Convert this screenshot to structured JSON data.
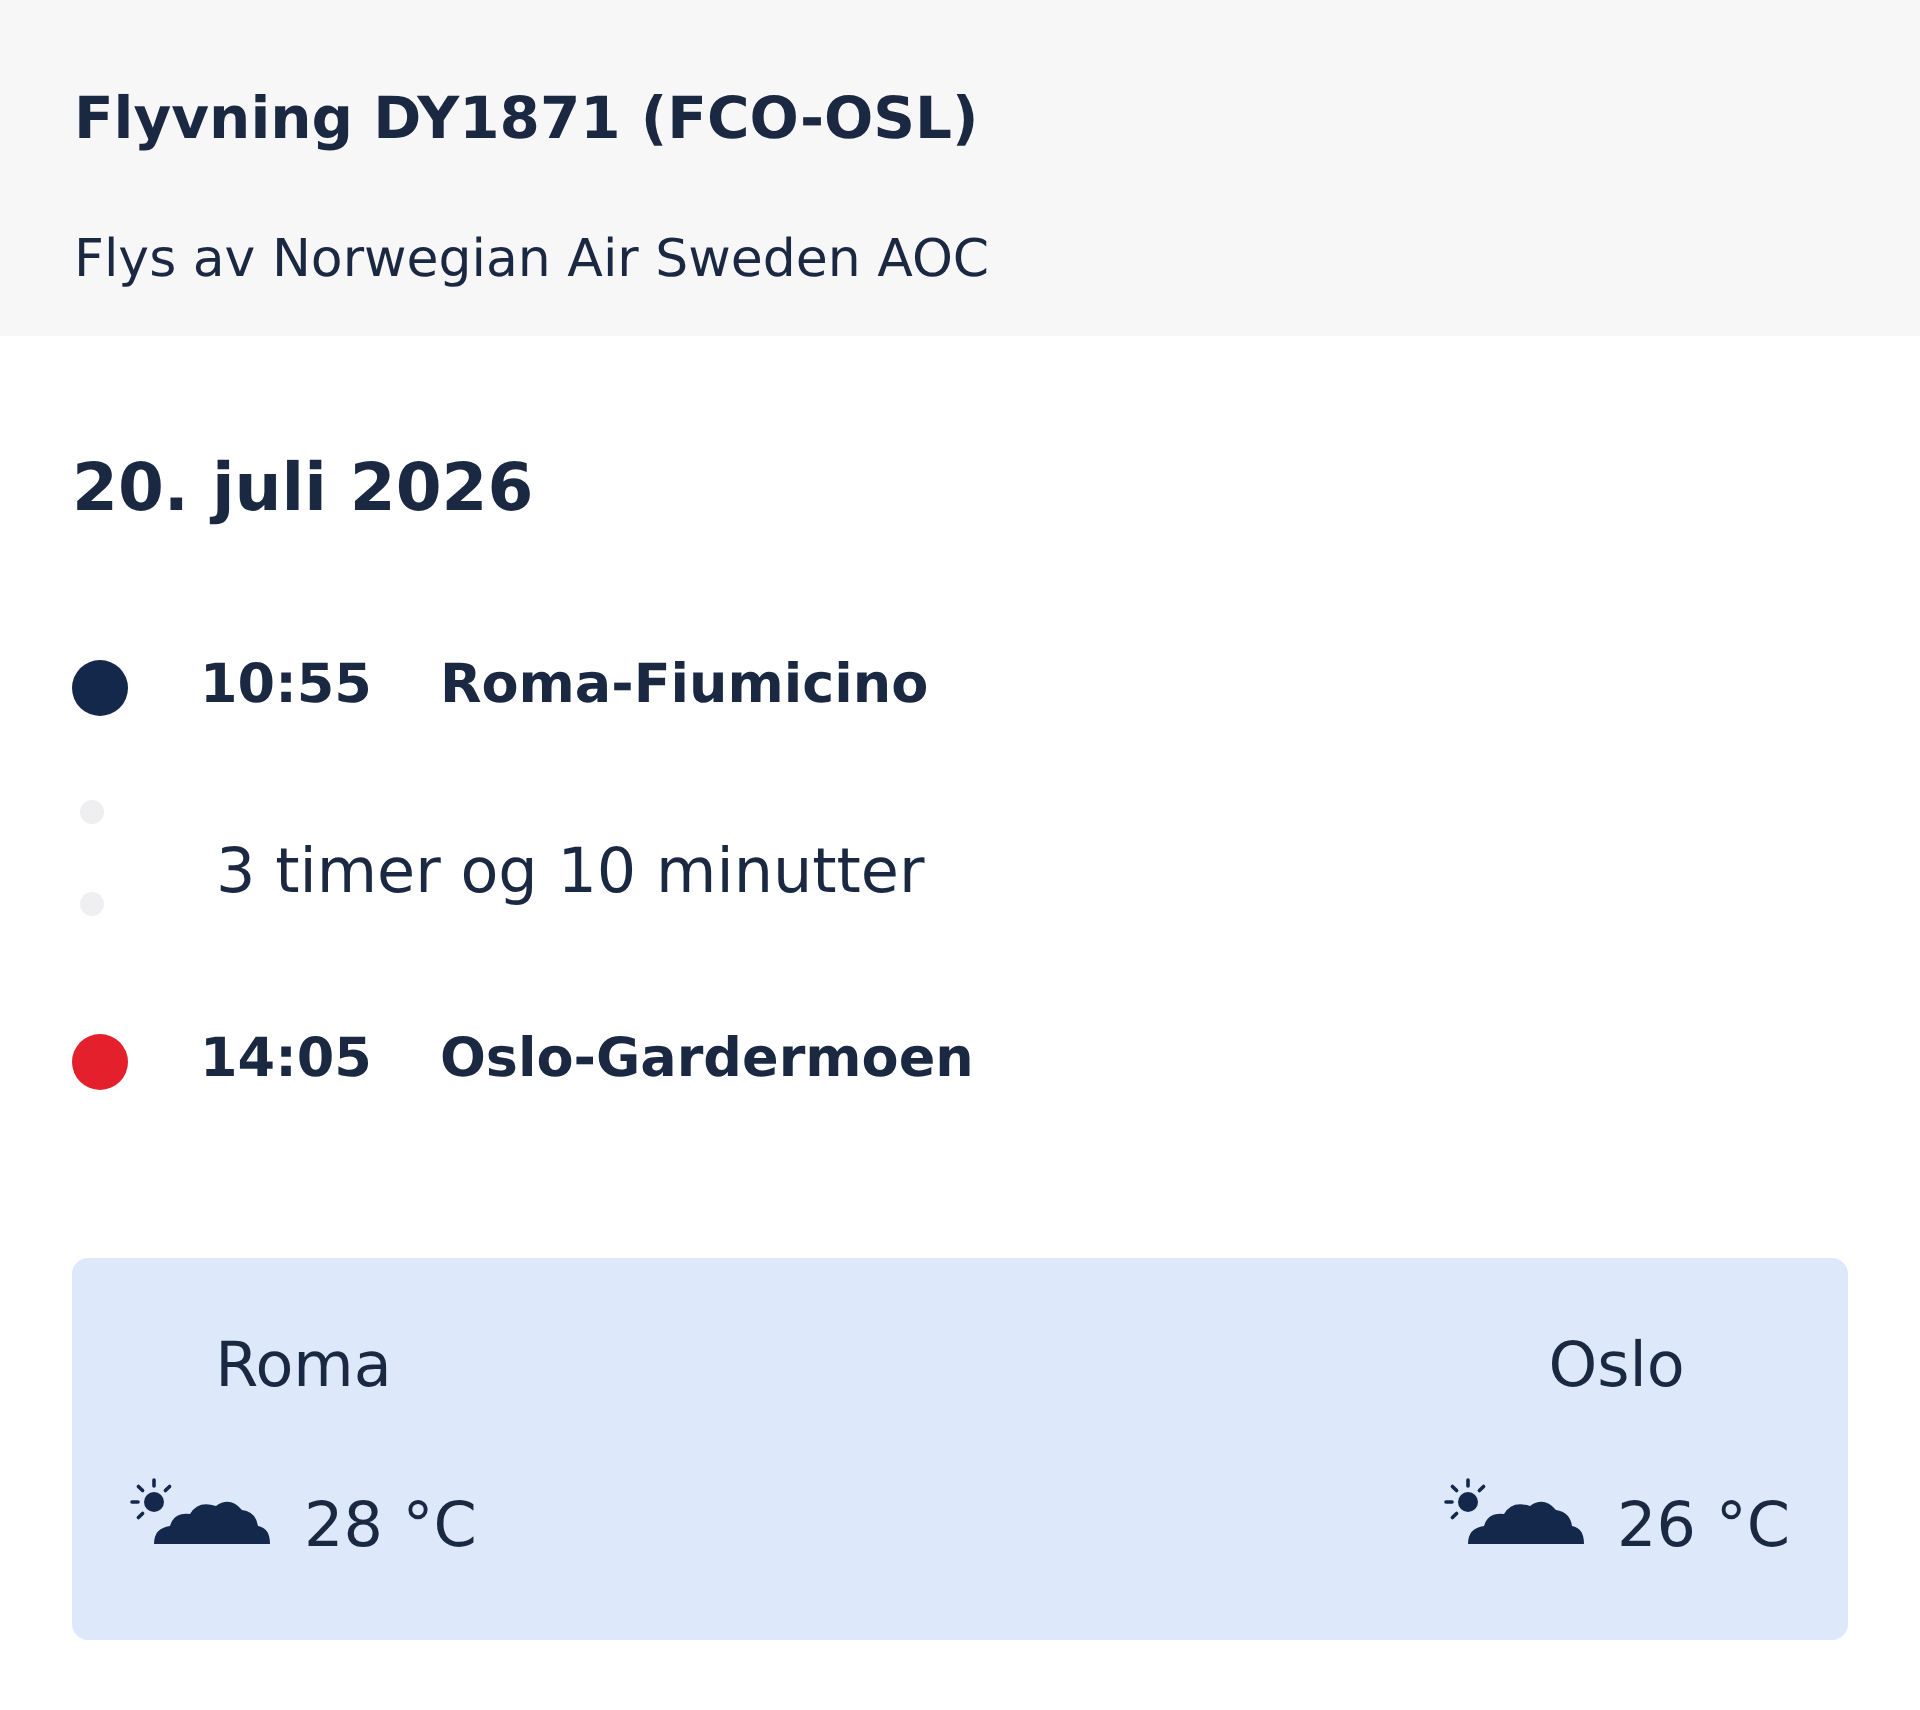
{
  "header": {
    "title": "Flyvning DY1871 (FCO-OSL)",
    "operator": "Flys av Norwegian Air Sweden AOC"
  },
  "date": "20. juli 2026",
  "timeline": [
    {
      "kind": "stop",
      "time": "10:55",
      "place": "Roma-Fiumicino",
      "color": "#14284b"
    },
    {
      "kind": "duration",
      "text": "3 timer og 10 minutter"
    },
    {
      "kind": "stop",
      "time": "14:05",
      "place": "Oslo-Gardermoen",
      "color": "#e3202c"
    }
  ],
  "weather": [
    {
      "city": "Roma",
      "temperature": "28 °C"
    },
    {
      "city": "Oslo",
      "temperature": "26 °C"
    }
  ]
}
